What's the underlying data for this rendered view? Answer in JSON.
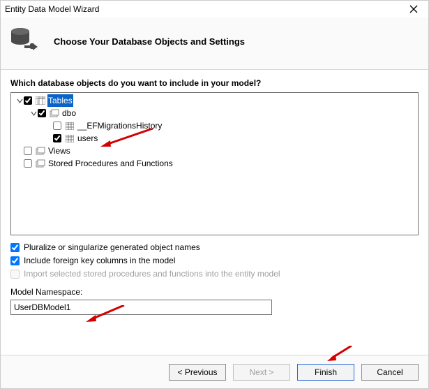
{
  "window": {
    "title": "Entity Data Model Wizard"
  },
  "header": {
    "title": "Choose Your Database Objects and Settings"
  },
  "prompt": "Which database objects do you want to include in your model?",
  "tree": {
    "tables": {
      "label": "Tables",
      "checked": true,
      "selected": true
    },
    "dbo": {
      "label": "dbo",
      "checked": true
    },
    "migrations": {
      "label": "__EFMigrationsHistory",
      "checked": false
    },
    "users": {
      "label": "users",
      "checked": true
    },
    "views": {
      "label": "Views",
      "checked": false
    },
    "sprocs": {
      "label": "Stored Procedures and Functions",
      "checked": false
    }
  },
  "options": {
    "pluralize": {
      "label": "Pluralize or singularize generated object names",
      "checked": true
    },
    "fkeys": {
      "label": "Include foreign key columns in the model",
      "checked": true
    },
    "import_sp": {
      "label": "Import selected stored procedures and functions into the entity model",
      "checked": false,
      "disabled": true
    }
  },
  "namespace": {
    "label": "Model Namespace:",
    "value": "UserDBModel1"
  },
  "buttons": {
    "previous": "< Previous",
    "next": "Next >",
    "finish": "Finish",
    "cancel": "Cancel"
  }
}
